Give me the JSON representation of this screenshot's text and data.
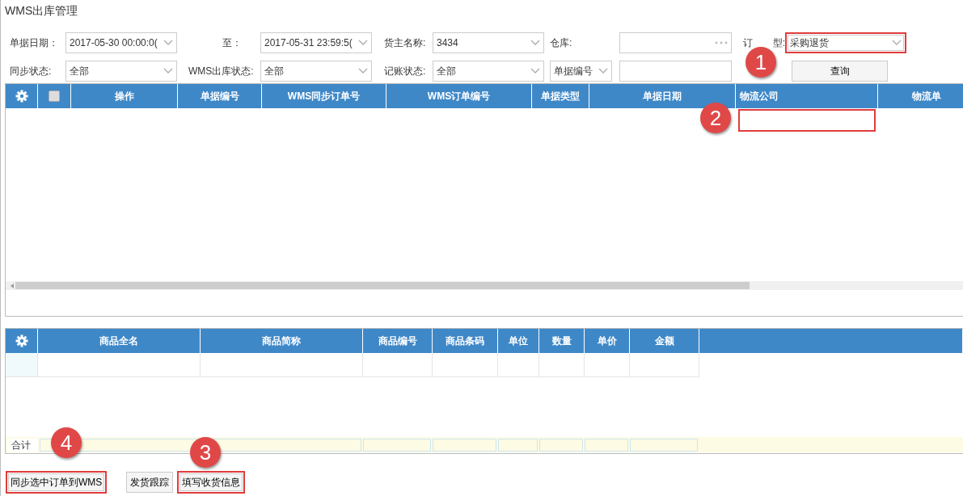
{
  "window": {
    "title": "WMS出库管理"
  },
  "filter_rows": [
    [
      {
        "kind": "label",
        "text": "单据日期："
      },
      {
        "kind": "select",
        "value": "2017-05-30 00:00:0("
      },
      {
        "kind": "label",
        "text": "至："
      },
      {
        "kind": "select",
        "value": "2017-05-31 23:59:5("
      },
      {
        "kind": "label",
        "text": "货主名称:"
      },
      {
        "kind": "select",
        "value": "3434"
      },
      {
        "kind": "label",
        "text": "仓库:"
      },
      {
        "kind": "lookup"
      },
      {
        "kind": "split_label",
        "parts": [
          "订",
          "型:"
        ]
      },
      {
        "kind": "select",
        "value": "采购退货",
        "highlighted": true
      }
    ],
    [
      {
        "kind": "label",
        "text": "同步状态:"
      },
      {
        "kind": "select",
        "value": "全部"
      },
      {
        "kind": "label",
        "text": "WMS出库状态:"
      },
      {
        "kind": "select",
        "value": "全部"
      },
      {
        "kind": "label",
        "text": "记账状态:"
      },
      {
        "kind": "select",
        "value": "全部"
      },
      {
        "kind": "select",
        "value": "单据编号"
      },
      {
        "kind": "input"
      },
      {
        "kind": "button",
        "label": "查询"
      }
    ]
  ],
  "orders_grid": {
    "columns": [
      {
        "kind": "gear"
      },
      {
        "kind": "checkbox",
        "checked": false
      },
      {
        "kind": "text",
        "label": "操作"
      },
      {
        "kind": "text",
        "label": "单据编号"
      },
      {
        "kind": "text",
        "label": "WMS同步订单号"
      },
      {
        "kind": "text",
        "label": "WMS订单编号"
      },
      {
        "kind": "text",
        "label": "单据类型"
      },
      {
        "kind": "text",
        "label": "单据日期"
      },
      {
        "kind": "text",
        "label": "物流公司",
        "highlighted": true
      },
      {
        "kind": "text",
        "label": "物流单"
      }
    ]
  },
  "items_grid": {
    "columns": [
      {
        "kind": "gear"
      },
      {
        "kind": "text",
        "label": "商品全名"
      },
      {
        "kind": "text",
        "label": "商品简称"
      },
      {
        "kind": "text",
        "label": "商品编号"
      },
      {
        "kind": "text",
        "label": "商品条码"
      },
      {
        "kind": "text",
        "label": "单位"
      },
      {
        "kind": "text",
        "label": "数量"
      },
      {
        "kind": "text",
        "label": "单价"
      },
      {
        "kind": "text",
        "label": "金额"
      }
    ],
    "footer": {
      "label": "合计"
    }
  },
  "buttons": [
    {
      "label": "同步选中订单到WMS",
      "highlighted": true
    },
    {
      "label": "发货跟踪",
      "highlighted": false
    },
    {
      "label": "填写收货信息",
      "highlighted": true
    }
  ],
  "annotations": [
    {
      "number": "1"
    },
    {
      "number": "2"
    },
    {
      "number": "3"
    },
    {
      "number": "4"
    }
  ]
}
